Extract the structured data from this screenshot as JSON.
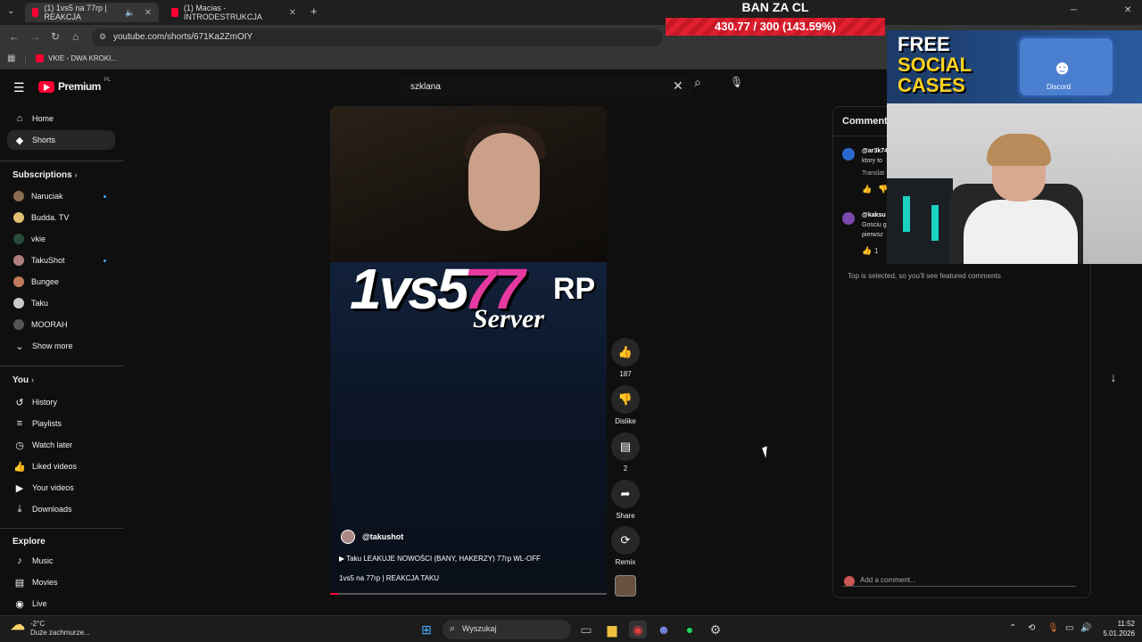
{
  "browser": {
    "tabs": [
      {
        "title": "(1) 1vs5 na 77rp | REAKCJA"
      },
      {
        "title": "(1) Macias - INTRODESTRUKCJA"
      }
    ],
    "new_tab_label": "+",
    "url": "youtube.com/shorts/671Ka2ZmOIY",
    "bookmark": "VKIE - DWA KROKI..."
  },
  "overlay": {
    "ban_title": "BAN ZA CL",
    "ban_progress": "430.77 / 300 (143.59%)",
    "promo_line1": "FREE",
    "promo_line2": "SOCIAL",
    "promo_line3": "CASES",
    "promo_case_label": "Discord"
  },
  "youtube": {
    "logo_text": "Premium",
    "logo_badge": "PL",
    "search": {
      "value": "szklana"
    },
    "sidebar": {
      "main": [
        {
          "label": "Home",
          "icon": "home-icon"
        },
        {
          "label": "Shorts",
          "icon": "shorts-icon",
          "selected": true
        }
      ],
      "subscriptions_header": "Subscriptions",
      "subscriptions": [
        {
          "label": "Naruciak",
          "color": "#8a6a50",
          "new": true
        },
        {
          "label": "Budda. TV",
          "color": "#e0c070",
          "new": false
        },
        {
          "label": "vkie",
          "color": "#2a4a3a",
          "new": false
        },
        {
          "label": "TakuShot",
          "color": "#b08080",
          "new": true
        },
        {
          "label": "Bungee",
          "color": "#c07a5a",
          "new": false
        },
        {
          "label": "Taku",
          "color": "#c9c9c9",
          "new": false
        },
        {
          "label": "MOORAH",
          "color": "#555555",
          "new": false
        }
      ],
      "show_more": "Show more",
      "you_header": "You",
      "you_items": [
        {
          "label": "History",
          "icon": "history-icon"
        },
        {
          "label": "Playlists",
          "icon": "playlists-icon"
        },
        {
          "label": "Watch later",
          "icon": "watch-later-icon"
        },
        {
          "label": "Liked videos",
          "icon": "liked-videos-icon"
        },
        {
          "label": "Your videos",
          "icon": "your-videos-icon"
        },
        {
          "label": "Downloads",
          "icon": "downloads-icon"
        }
      ],
      "explore_header": "Explore",
      "explore_items": [
        {
          "label": "Music",
          "icon": "music-icon"
        },
        {
          "label": "Movies",
          "icon": "movies-icon"
        },
        {
          "label": "Live",
          "icon": "live-icon"
        }
      ]
    },
    "short": {
      "logo_1vs5": "1vs5",
      "logo_77": "77",
      "logo_rp": "RP",
      "logo_server": "Server",
      "channel": "@takushot",
      "title": "Taku LEAKUJE NOWOŚCI (BANY, HAKERZY) 77rp WL-OFF",
      "subtitle": "1vs5 na 77rp | REAKCJA TAKU",
      "progress": 0.03
    },
    "actions": {
      "like_count": "187",
      "dislike_label": "Dislike",
      "comment_count": "2",
      "share_label": "Share",
      "remix_label": "Remix"
    },
    "comments": {
      "header": "Comments",
      "items": [
        {
          "user": "@ar3k74",
          "text": "ktory to",
          "extra": "Translat",
          "color": "#2a6ad0"
        },
        {
          "user": "@kaksu",
          "text": "Gosciu g",
          "extra": "pierwsz",
          "color": "#7a4ab0"
        }
      ],
      "reply_count": "1",
      "featured_note": "Top is selected, so you'll see featured comments",
      "add_placeholder": "Add a comment..."
    }
  },
  "taskbar": {
    "weather_temp": "-2°C",
    "weather_desc": "Duże zachmurze...",
    "search_label": "Wyszukaj",
    "time": "11:52",
    "date": "5.01.2026"
  }
}
